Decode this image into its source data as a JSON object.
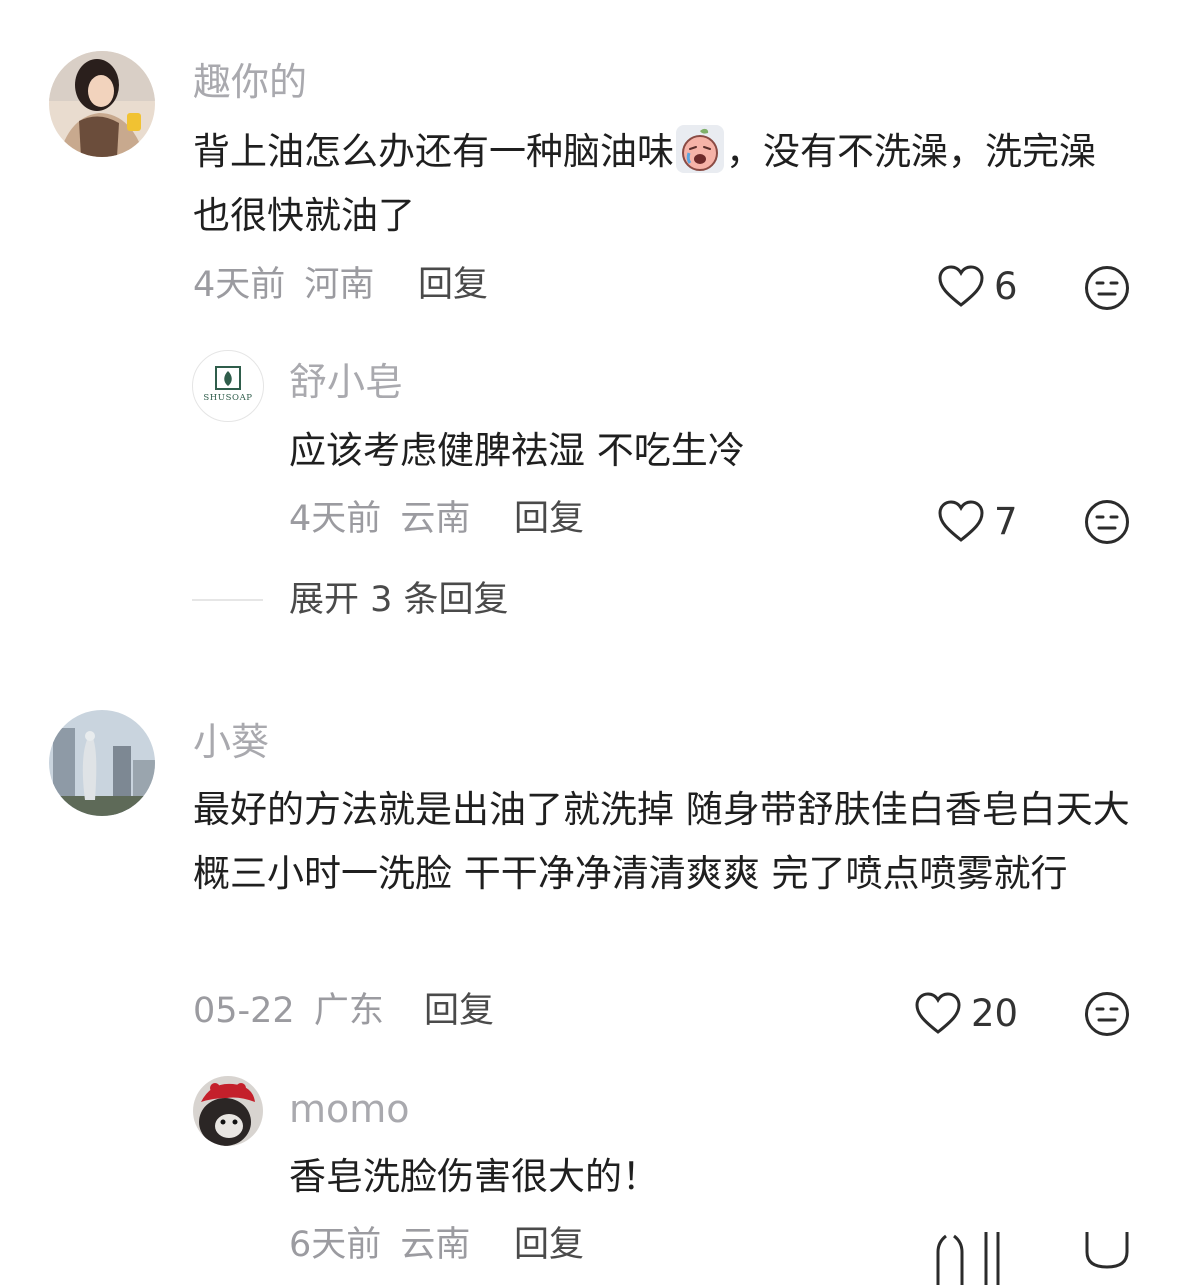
{
  "comments": [
    {
      "user": "趣你的",
      "text_before_emoji": "背上油怎么办还有一种脑油味",
      "text_after_emoji": "，没有不洗澡，洗完澡也很快就油了",
      "time": "4天前",
      "location": "河南",
      "reply_label": "回复",
      "likes": "6",
      "replies": [
        {
          "user": "舒小皂",
          "avatar_text": "SHUSOAP",
          "text": "应该考虑健脾祛湿 不吃生冷",
          "time": "4天前",
          "location": "云南",
          "reply_label": "回复",
          "likes": "7"
        }
      ],
      "expand_label": "展开 3 条回复"
    },
    {
      "user": "小葵",
      "text": "最好的方法就是出油了就洗掉 随身带舒肤佳白香皂白天大概三小时一洗脸 干干净净清清爽爽 完了喷点喷雾就行",
      "time": "05-22",
      "location": "广东",
      "reply_label": "回复",
      "likes": "20",
      "replies": [
        {
          "user": "momo",
          "text": "香皂洗脸伤害很大的！",
          "time": "6天前",
          "location": "云南",
          "reply_label": "回复"
        }
      ]
    }
  ],
  "icons": {
    "like": "heart-outline-icon",
    "dislike": "meh-face-icon",
    "emoji": "crying-peach-emoji"
  },
  "colors": {
    "username": "#a9a9ae",
    "text": "#1f1f1f",
    "meta": "#9b9ba0"
  }
}
